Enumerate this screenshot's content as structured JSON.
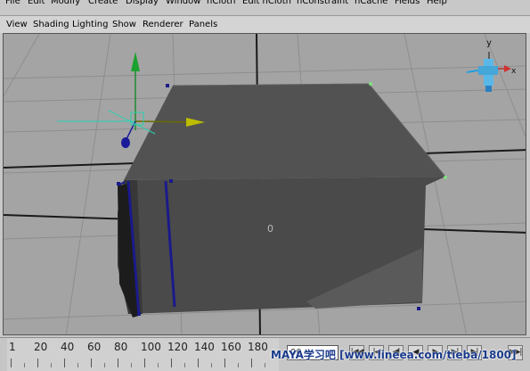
{
  "menubar": [
    "File",
    "Edit",
    "Modify",
    "Create",
    "Display",
    "Window",
    "nCloth",
    "Edit nCloth",
    "nConstraint",
    "nCache",
    "Fields",
    "Help"
  ],
  "panel_menu": [
    "View",
    "Shading",
    "Lighting",
    "Show",
    "Renderer",
    "Panels"
  ],
  "viewport": {
    "object_label": "0",
    "axis_labels": {
      "y": "y",
      "x": "x"
    }
  },
  "timeline": {
    "tick_labels": [
      "1",
      "20",
      "40",
      "60",
      "80",
      "100",
      "120",
      "140",
      "160",
      "180"
    ],
    "current_frame": "00",
    "playback_buttons": [
      {
        "name": "go-to-start-button",
        "glyph": "|◀◀"
      },
      {
        "name": "step-back-button",
        "glyph": "|◀"
      },
      {
        "name": "step-back-key-button",
        "glyph": "◀|"
      },
      {
        "name": "play-backwards-button",
        "glyph": "◀"
      },
      {
        "name": "play-forwards-button",
        "glyph": "▶"
      },
      {
        "name": "step-forward-key-button",
        "glyph": "▶|"
      },
      {
        "name": "step-forward-button",
        "glyph": "▶|"
      },
      {
        "name": "go-to-end-button",
        "glyph": "▶▶|"
      }
    ]
  },
  "watermark": "MAYA学习吧 [www.lineea.com/tieba/1800]"
}
